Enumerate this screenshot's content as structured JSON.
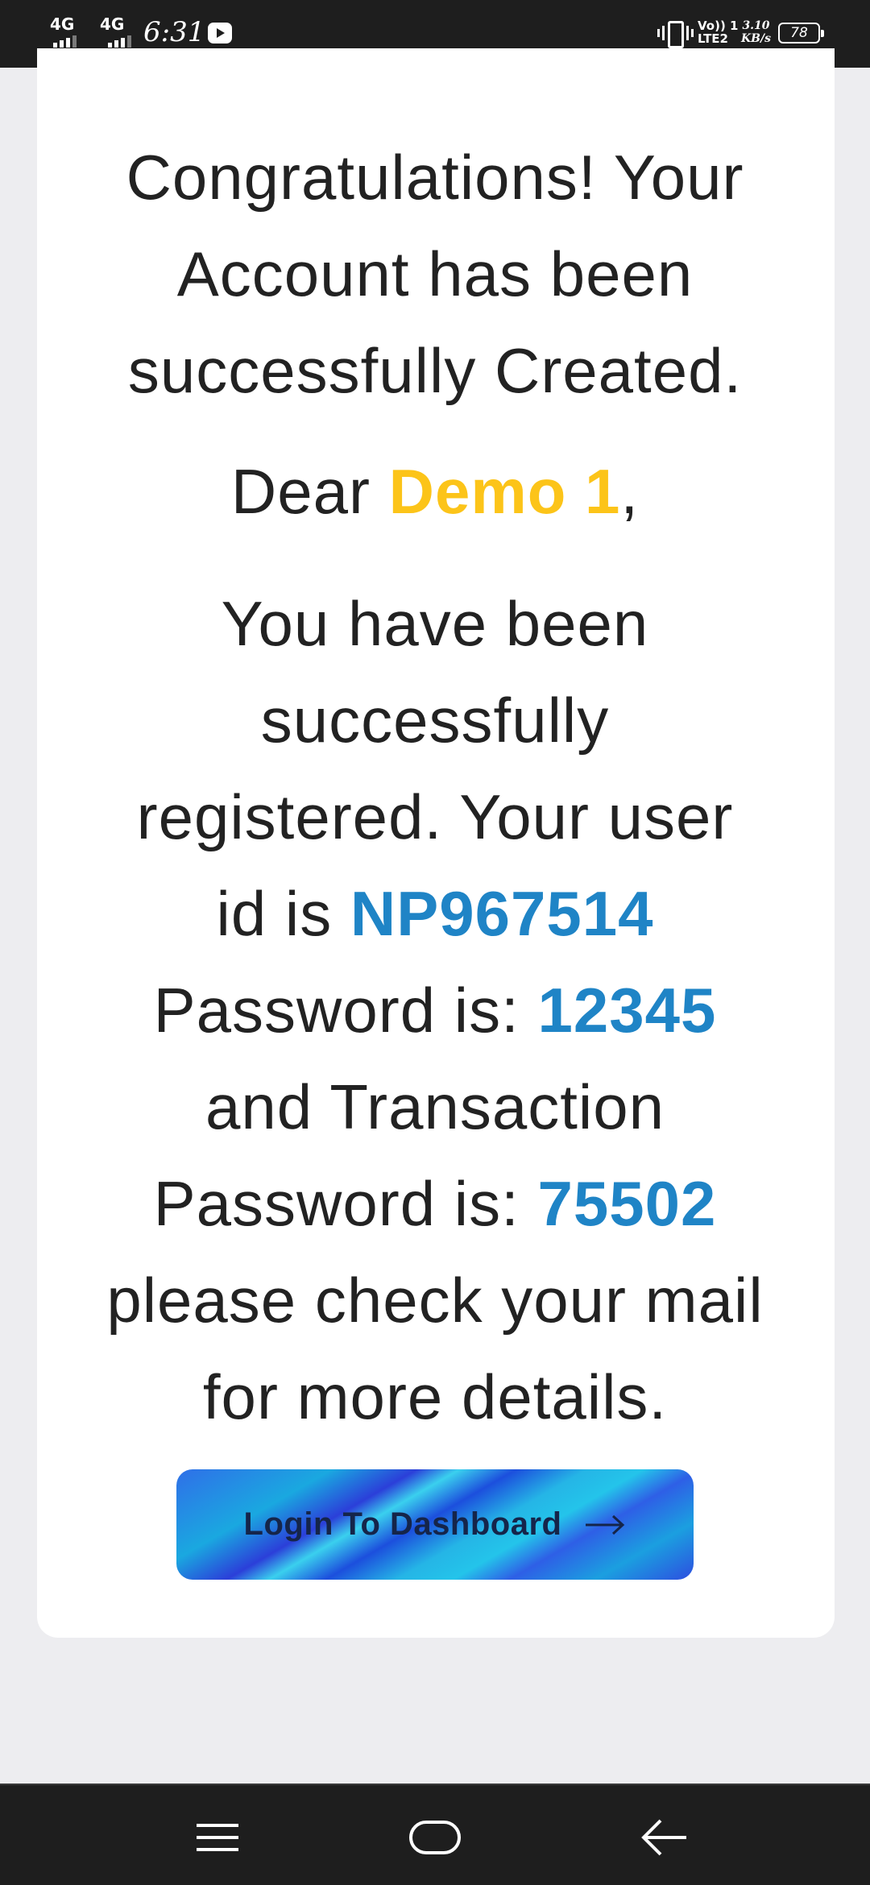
{
  "status_bar": {
    "network1": "4G",
    "network2": "4G",
    "time": "6:31",
    "volte_line1": "Vo)) 1",
    "volte_line2": "LTE2",
    "speed_value": "3.10",
    "speed_unit": "KB/s",
    "battery": "78"
  },
  "message": {
    "heading_line1": "Congratulations! Your",
    "heading_line2": "Account has been",
    "heading_line3": "successfully Created.",
    "dear_prefix": "Dear ",
    "user_name": "Demo 1",
    "dear_suffix": ",",
    "line1": "You have been",
    "line2": "successfully",
    "line3": "registered. Your user",
    "userid_prefix": "id is ",
    "user_id": "NP967514",
    "password_prefix": "Password is: ",
    "password": "12345",
    "line_and": "and Transaction",
    "txn_password_prefix": "Password is: ",
    "txn_password": "75502",
    "line_mail": "please check your mail",
    "line_details": "for more details."
  },
  "button": {
    "label": "Login To Dashboard",
    "icon": "arrow-right-icon"
  },
  "nav_bar": {
    "icons": [
      "menu-icon",
      "home-icon",
      "back-icon"
    ]
  },
  "colors": {
    "highlight_name": "#fcc419",
    "highlight_values": "#1f84c6",
    "text": "#222222",
    "page_bg": "#ededf0",
    "system_bar": "#1e1e1e"
  }
}
